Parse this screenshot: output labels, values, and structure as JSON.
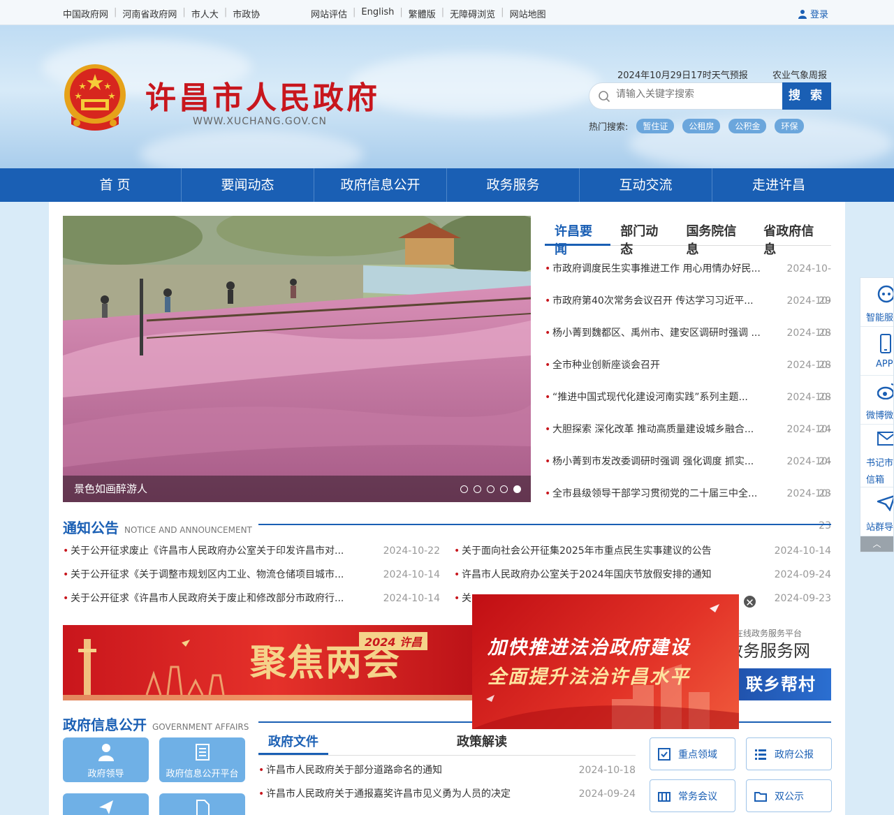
{
  "topbar": {
    "links": [
      "中国政府网",
      "河南省政府网",
      "市人大",
      "市政协"
    ],
    "links2": [
      "网站评估",
      "English",
      "繁體版",
      "无障碍浏览",
      "网站地图"
    ],
    "login": "登录"
  },
  "header": {
    "title": "许昌市人民政府",
    "domain": "WWW.XUCHANG.GOV.CN",
    "weather": "2024年10月29日17时天气预报",
    "agri": "农业气象周报",
    "search_placeholder": "请输入关键字搜索",
    "search_button": "搜 索",
    "hot_label": "热门搜索:",
    "hot_tags": [
      "暂住证",
      "公租房",
      "公积金",
      "环保"
    ]
  },
  "nav": [
    "首 页",
    "要闻动态",
    "政府信息公开",
    "政务服务",
    "互动交流",
    "走进许昌"
  ],
  "slider": {
    "caption": "景色如画醉游人",
    "dots": 5,
    "active_dot": 5
  },
  "news": {
    "tabs": [
      "许昌要闻",
      "部门动态",
      "国务院信息",
      "省政府信息"
    ],
    "items": [
      {
        "title": "市政府调度民生实事推进工作 用心用情办好民...",
        "date": "2024-10-29"
      },
      {
        "title": "市政府第40次常务会议召开 传达学习习近平...",
        "date": "2024-10-28"
      },
      {
        "title": "杨小菁到魏都区、禹州市、建安区调研时强调 ...",
        "date": "2024-10-28"
      },
      {
        "title": "全市种业创新座谈会召开",
        "date": "2024-10-28"
      },
      {
        "title": "“推进中国式现代化建设河南实践”系列主题...",
        "date": "2024-10-24"
      },
      {
        "title": "大胆探索 深化改革 推动高质量建设城乡融合...",
        "date": "2024-10-24"
      },
      {
        "title": "杨小菁到市发改委调研时强调 强化调度 抓实...",
        "date": "2024-10-23"
      },
      {
        "title": "全市县级领导干部学习贯彻党的二十届三中全...",
        "date": "2024-10-23"
      }
    ]
  },
  "notice": {
    "title": "通知公告",
    "title_en": "NOTICE AND ANNOUNCEMENT",
    "left": [
      {
        "title": "关于公开征求废止《许昌市人民政府办公室关于印发许昌市对...",
        "date": "2024-10-22"
      },
      {
        "title": "关于公开征求《关于调整市规划区内工业、物流仓储项目城市...",
        "date": "2024-10-14"
      },
      {
        "title": "关于公开征求《许昌市人民政府关于废止和修改部分市政府行...",
        "date": "2024-10-14"
      }
    ],
    "right": [
      {
        "title": "关于面向社会公开征集2025年市重点民生实事建议的公告",
        "date": "2024-10-14"
      },
      {
        "title": "许昌市人民政府办公室关于2024年国庆节放假安排的通知",
        "date": "2024-09-24"
      },
      {
        "title": "关",
        "date": "2024-09-23"
      }
    ]
  },
  "banner": {
    "title": "聚焦两会",
    "year": "2024 许昌"
  },
  "service": {
    "label": "化在线政务服务平台",
    "title": "政务服务网",
    "banner": "联乡帮村"
  },
  "popup": {
    "line1": "加快推进法治政府建设",
    "line2": "全面提升法治许昌水平",
    "close": "✕"
  },
  "govinfo": {
    "title": "政府信息公开",
    "title_en": "GOVERNMENT AFFAIRS",
    "tiles": [
      "政府领导",
      "政府信息公开平台"
    ],
    "tabs": [
      "政府文件",
      "政策解读"
    ],
    "items": [
      {
        "title": "许昌市人民政府关于部分道路命名的通知",
        "date": "2024-10-18"
      },
      {
        "title": "许昌市人民政府关于通报嘉奖许昌市见义勇为人员的决定",
        "date": "2024-09-24"
      }
    ],
    "quick": [
      "重点领域",
      "政府公报",
      "常务会议",
      "双公示"
    ]
  },
  "floatbar": [
    "智能服",
    "APP",
    "微博微",
    "书记市长信箱",
    "站群导"
  ],
  "colors": {
    "primary": "#1a5fb4",
    "red": "#c8161d"
  }
}
